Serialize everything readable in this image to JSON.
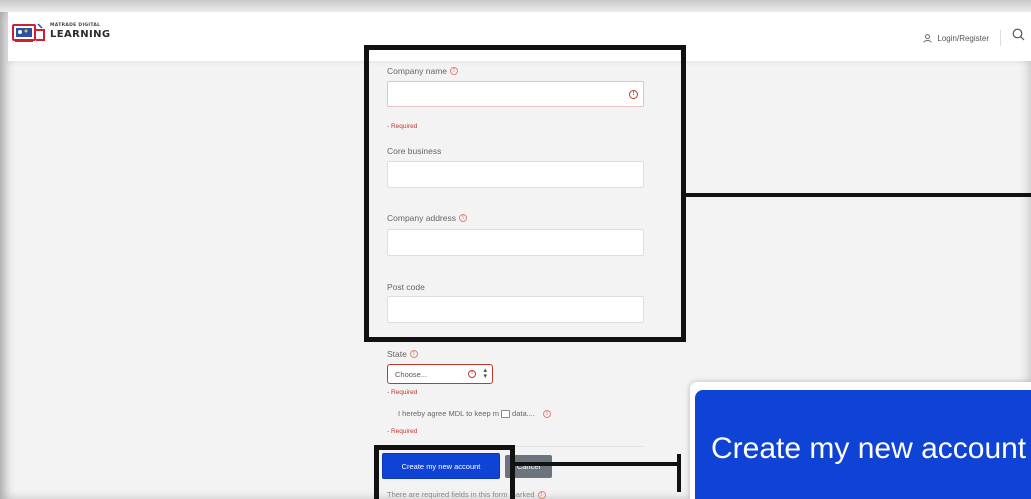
{
  "brand": {
    "logo_small": "MATRADE DIGITAL",
    "logo_big": "LEARNING"
  },
  "header": {
    "login_label": "Login/Register"
  },
  "form": {
    "company_name_label": "Company name",
    "company_name_required": "- Required",
    "core_business_label": "Core business",
    "company_address_label": "Company address",
    "post_code_label": "Post code",
    "state_label": "State",
    "state_selected": "Choose...",
    "state_required": "- Required",
    "agree_text_before": "I hereby agree MDL to keep m",
    "agree_text_after": "data....",
    "agree_required": "- Required",
    "submit_label": "Create my new account",
    "cancel_label": "Cancel",
    "footnote": "There are required fields in this form marked"
  },
  "zoom": {
    "button_text": "Create my new account"
  },
  "colors": {
    "primary": "#0f43d6",
    "error": "#c0392b",
    "cancel": "#6c757d"
  }
}
